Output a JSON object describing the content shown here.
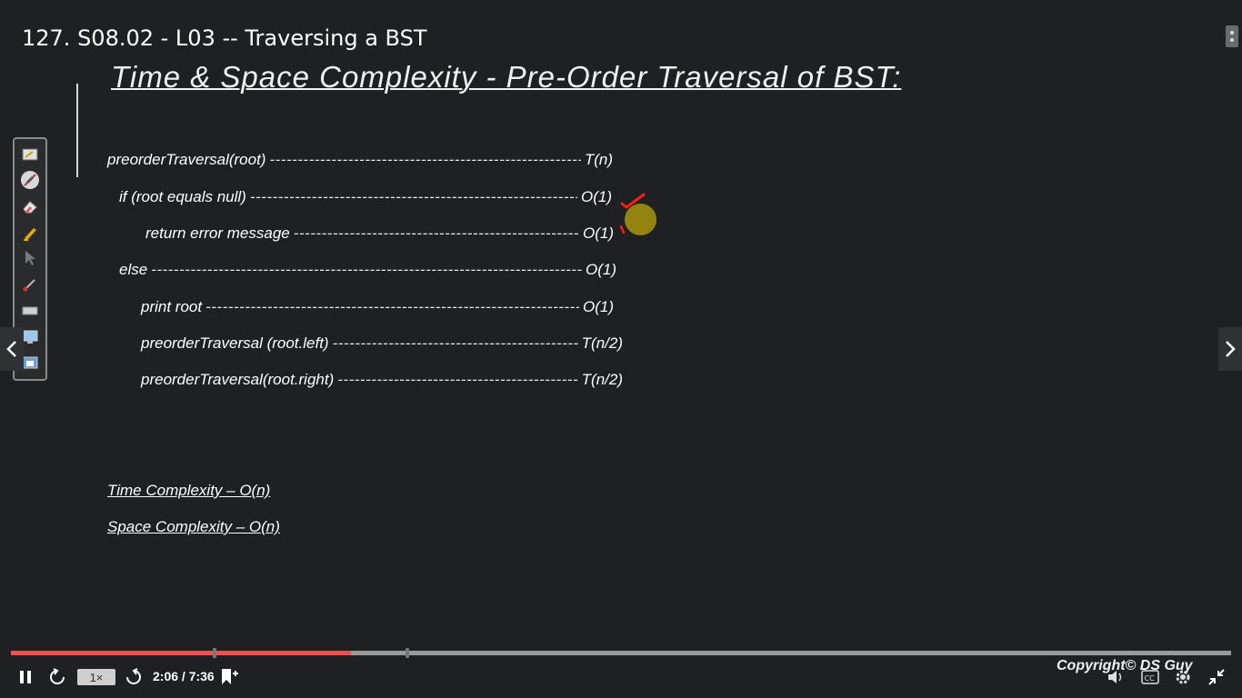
{
  "video": {
    "title": "127. S08.02 - L03 -- Traversing a BST"
  },
  "slide": {
    "title": "Time & Space Complexity - Pre-Order Traversal of BST:",
    "code_lines": [
      {
        "code": "preorderTraversal(root)",
        "cost": "T(n)"
      },
      {
        "code": "if (root equals null)",
        "cost": "O(1)"
      },
      {
        "code": "return error message",
        "cost": "O(1)"
      },
      {
        "code": "else",
        "cost": "O(1)"
      },
      {
        "code": "print root",
        "cost": "O(1)"
      },
      {
        "code": "preorderTraversal (root.left)",
        "cost": "T(n/2)"
      },
      {
        "code": "preorderTraversal(root.right)",
        "cost": "T(n/2)"
      }
    ],
    "time_complexity": "Time Complexity – O(n)",
    "space_complexity": "Space Complexity – O(n)",
    "copyright": "Copyright© DS Guy"
  },
  "annotation": {
    "pointer_color": "#9a8a10",
    "mark_color": "#ff1a1a"
  },
  "player": {
    "speed": "1×",
    "time_display": "2:06 / 7:36",
    "progress_fraction": 0.279,
    "accent_color": "#ec5252"
  }
}
